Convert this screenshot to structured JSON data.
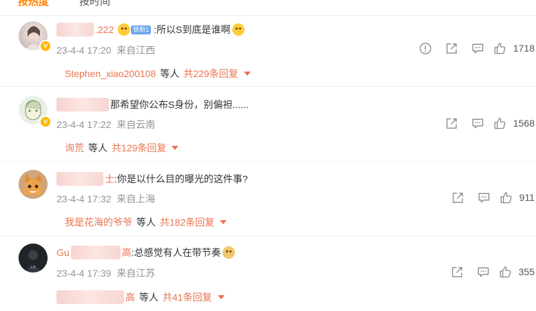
{
  "tabs": {
    "hot": "按热度",
    "time": "按时间"
  },
  "comments": [
    {
      "name_visible": ".222",
      "fan_badge": "铁粉1",
      "text": ":所以S到底是谁啊",
      "date": "23-4-4 17:20",
      "location": "来自江西",
      "likes": "1718",
      "reply_user": "Stephen_xiao200108",
      "reply_mid": "等人",
      "reply_count": "共229条回复"
    },
    {
      "name_visible": "",
      "text": "那希望你公布S身份，别偏袒......",
      "date": "23-4-4 17:22",
      "location": "来自云南",
      "likes": "1568",
      "reply_user": "询荒",
      "reply_mid": "等人",
      "reply_count": "共129条回复"
    },
    {
      "name_visible": "士",
      "text": ":你是以什么目的曝光的这件事?",
      "date": "23-4-4 17:32",
      "location": "来自上海",
      "likes": "911",
      "reply_user": "我是花海的爷爷",
      "reply_mid": "等人",
      "reply_count": "共182条回复"
    },
    {
      "name_visible": "Gu",
      "name_visible_2": "高",
      "text": ":总感觉有人在带节奏",
      "date": "23-4-4 17:39",
      "location": "来自江苏",
      "likes": "355",
      "reply_user": "高",
      "reply_mid": "等人",
      "reply_count": "共41条回复"
    }
  ]
}
